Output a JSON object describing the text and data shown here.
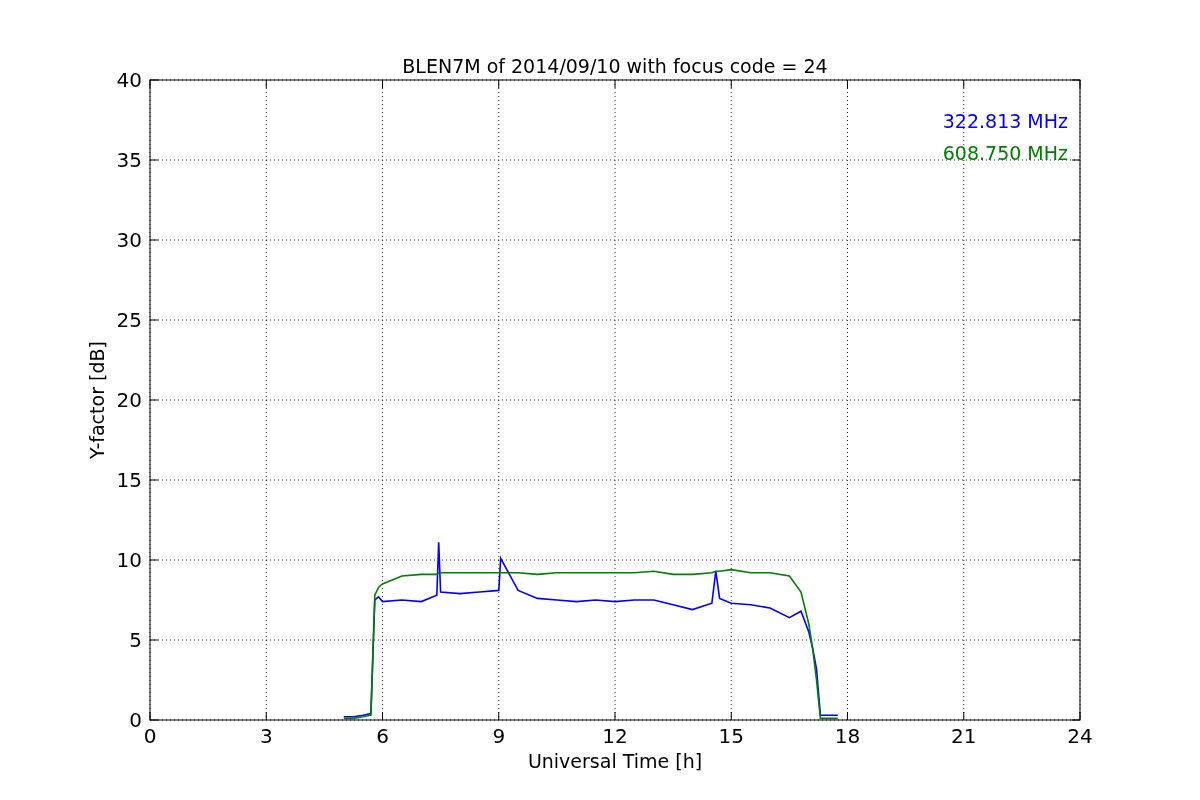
{
  "chart_data": {
    "type": "line",
    "title": "BLEN7M of 2014/09/10 with focus code = 24",
    "xlabel": "Universal Time [h]",
    "ylabel": "Y-factor [dB]",
    "x": [
      5.0,
      5.25,
      5.5,
      5.7,
      5.8,
      5.9,
      6.0,
      6.5,
      7.0,
      7.4,
      7.45,
      7.5,
      8.0,
      8.5,
      9.0,
      9.05,
      9.5,
      10.0,
      10.5,
      11.0,
      11.5,
      12.0,
      12.5,
      13.0,
      13.5,
      14.0,
      14.5,
      14.6,
      14.7,
      15.0,
      15.5,
      16.0,
      16.5,
      16.8,
      17.0,
      17.1,
      17.2,
      17.3,
      17.5,
      17.75
    ],
    "series": [
      {
        "name": "322.813 MHz",
        "color": "#0000ff",
        "values": [
          0.2,
          0.2,
          0.3,
          0.4,
          7.5,
          7.7,
          7.4,
          7.5,
          7.4,
          7.8,
          11.1,
          8.0,
          7.9,
          8.0,
          8.1,
          10.1,
          8.1,
          7.6,
          7.5,
          7.4,
          7.5,
          7.4,
          7.5,
          7.5,
          7.2,
          6.9,
          7.3,
          9.3,
          7.6,
          7.3,
          7.2,
          7.0,
          6.4,
          6.8,
          5.5,
          4.5,
          3.2,
          0.3,
          0.3,
          0.3
        ]
      },
      {
        "name": "608.750 MHz",
        "color": "#008000",
        "values": [
          0.1,
          0.1,
          0.2,
          0.3,
          7.8,
          8.3,
          8.5,
          9.0,
          9.1,
          9.1,
          9.2,
          9.2,
          9.2,
          9.2,
          9.2,
          9.2,
          9.2,
          9.1,
          9.2,
          9.2,
          9.2,
          9.2,
          9.2,
          9.3,
          9.1,
          9.1,
          9.2,
          9.3,
          9.3,
          9.4,
          9.2,
          9.2,
          9.0,
          8.0,
          6.0,
          4.5,
          2.5,
          0.1,
          0.1,
          0.1
        ]
      }
    ],
    "xlim": [
      0,
      24
    ],
    "ylim": [
      0,
      40
    ],
    "xticks": [
      0,
      3,
      6,
      9,
      12,
      15,
      18,
      21,
      24
    ],
    "yticks": [
      0,
      5,
      10,
      15,
      20,
      25,
      30,
      35,
      40
    ],
    "grid": true
  }
}
